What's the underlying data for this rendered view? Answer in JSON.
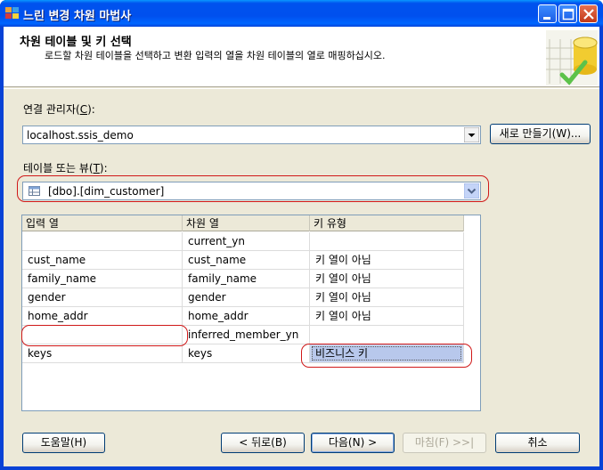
{
  "window": {
    "title": "느린 변경 차원 마법사"
  },
  "colors": {
    "accent": "#0054e3",
    "highlight_outline": "#d01818",
    "selected_cell": "#c6d3ef"
  },
  "banner": {
    "title": "차원 테이블 및 키 선택",
    "subtitle": "로드할 차원 테이블을 선택하고 변환 입력의 열을 차원 테이블의 열로 매핑하십시오."
  },
  "connection": {
    "label_prefix": "연결 관리자(",
    "label_key": "C",
    "label_suffix": "):",
    "value": "localhost.ssis_demo",
    "new_button": "새로 만들기(W)..."
  },
  "table": {
    "label_prefix": "테이블 또는 뷰(",
    "label_key": "T",
    "label_suffix": "):",
    "value": "[dbo].[dim_customer]"
  },
  "grid": {
    "headers": [
      "입력 열",
      "차원 열",
      "키 유형"
    ],
    "rows": [
      {
        "input": "",
        "dimension": "current_yn",
        "key_type": ""
      },
      {
        "input": "cust_name",
        "dimension": "cust_name",
        "key_type": "키 열이 아님"
      },
      {
        "input": "family_name",
        "dimension": "family_name",
        "key_type": "키 열이 아님"
      },
      {
        "input": "gender",
        "dimension": "gender",
        "key_type": "키 열이 아님"
      },
      {
        "input": "home_addr",
        "dimension": "home_addr",
        "key_type": "키 열이 아님"
      },
      {
        "input": "",
        "dimension": "inferred_member_yn",
        "key_type": ""
      },
      {
        "input": "keys",
        "dimension": "keys",
        "key_type": "비즈니스 키"
      }
    ]
  },
  "footer": {
    "help": "도움말(H)",
    "back": "< 뒤로(B)",
    "next": "다음(N) >",
    "finish": "마침(F) >>|",
    "cancel": "취소"
  },
  "icons": {
    "app": "wizard-app-icon",
    "banner": "database-table-icon",
    "table_combo": "table-icon"
  }
}
